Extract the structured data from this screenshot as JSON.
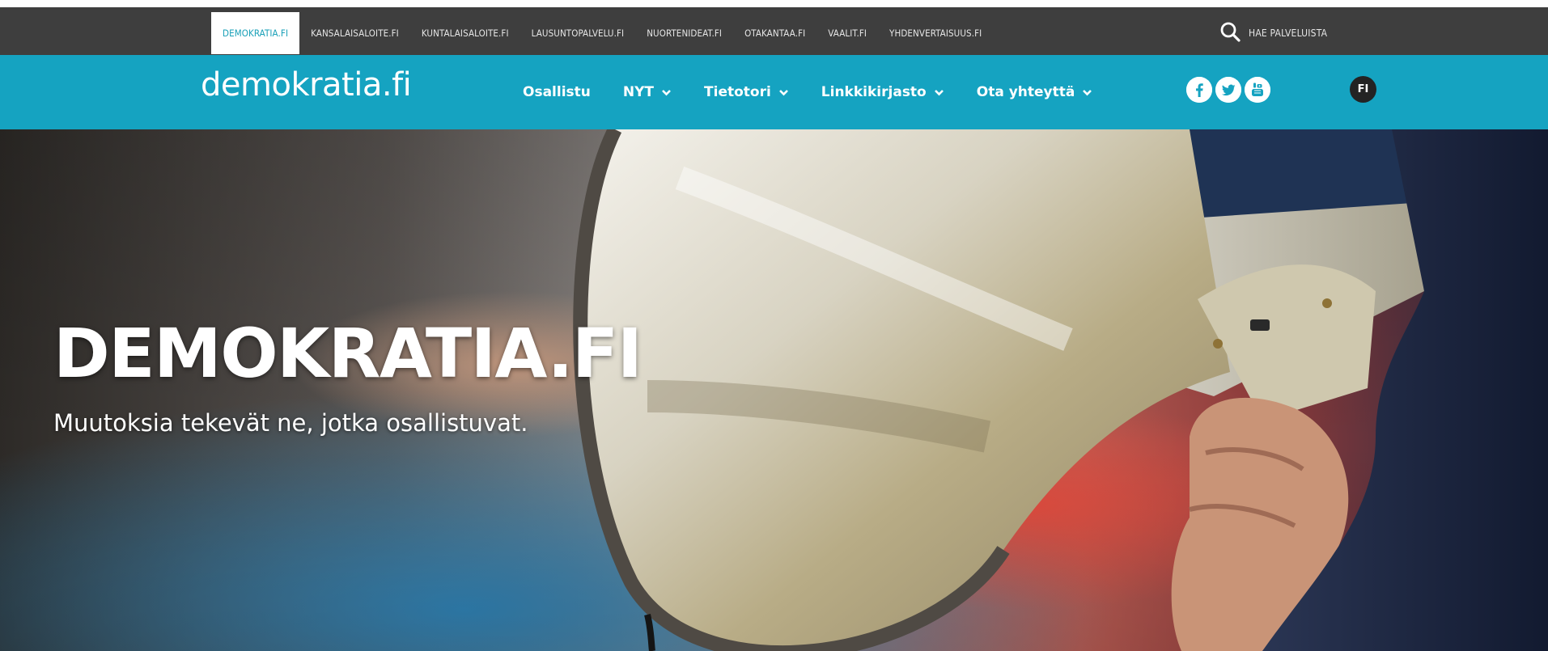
{
  "service_bar": {
    "links": [
      {
        "label": "DEMOKRATIA.FI",
        "active": true
      },
      {
        "label": "KANSALAISALOITE.FI",
        "active": false
      },
      {
        "label": "KUNTALAISALOITE.FI",
        "active": false
      },
      {
        "label": "LAUSUNTOPALVELU.FI",
        "active": false
      },
      {
        "label": "NUORTENIDEAT.FI",
        "active": false
      },
      {
        "label": "OTAKANTAA.FI",
        "active": false
      },
      {
        "label": "VAALIT.FI",
        "active": false
      },
      {
        "label": "YHDENVERTAISUUS.FI",
        "active": false
      }
    ],
    "search_label": "HAE PALVELUISTA",
    "search_icon": "search-icon"
  },
  "header": {
    "logo": "demokratia.fi",
    "menu": [
      {
        "label": "Osallistu",
        "has_dropdown": false
      },
      {
        "label": "NYT",
        "has_dropdown": true
      },
      {
        "label": "Tietotori",
        "has_dropdown": true
      },
      {
        "label": "Linkkikirjasto",
        "has_dropdown": true
      },
      {
        "label": "Ota yhteyttä",
        "has_dropdown": true
      }
    ],
    "social_icons": [
      "facebook-icon",
      "twitter-icon",
      "youtube-icon"
    ],
    "language": "FI"
  },
  "hero": {
    "title": "DEMOKRATIA.FI",
    "subtitle": "Muutoksia tekevät ne, jotka osallistuvat.",
    "image": "megaphone-photo"
  },
  "colors": {
    "service_bar": "#3e3e3e",
    "brand_teal": "#15a3c1",
    "active_link_text": "#1aa0b8",
    "language_badge": "#232323"
  }
}
